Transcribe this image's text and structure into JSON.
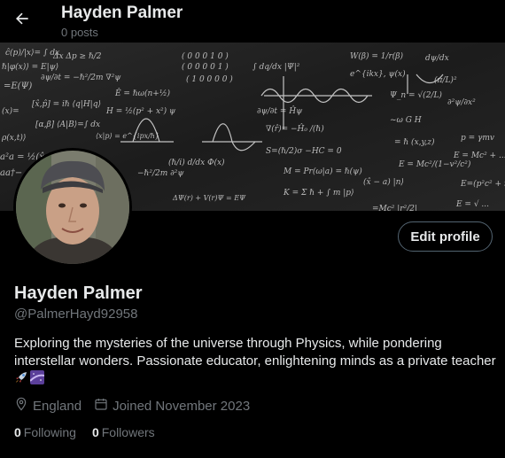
{
  "header": {
    "back_icon": "arrow-left-icon",
    "title": "Hayden Palmer",
    "posts": "0 posts"
  },
  "profile": {
    "name": "Hayden Palmer",
    "handle": "@PalmerHayd92958",
    "edit_label": "Edit profile",
    "bio": "Exploring the mysteries of the universe through Physics, while pondering interstellar wonders. Passionate educator, enlightening minds as a private teacher",
    "bio_emojis": [
      "rocket-emoji",
      "milky-way-emoji"
    ],
    "location": "England",
    "joined": "Joined November 2023",
    "following_count": "0",
    "following_label": "Following",
    "followers_count": "0",
    "followers_label": "Followers"
  },
  "colors": {
    "background": "#000000",
    "text": "#e7e9ea",
    "muted": "#71767b",
    "border": "#536471"
  }
}
